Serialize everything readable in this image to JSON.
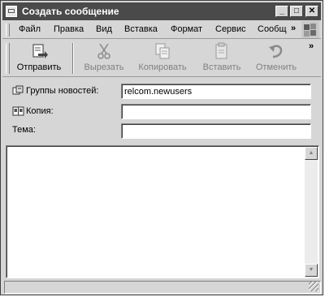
{
  "window": {
    "title": "Создать сообщение"
  },
  "titlebar_buttons": {
    "minimize": "_",
    "maximize": "□",
    "close": "✕"
  },
  "menu": {
    "items": [
      "Файл",
      "Правка",
      "Вид",
      "Вставка",
      "Формат",
      "Сервис",
      "Сообщ"
    ],
    "overflow": "»"
  },
  "toolbar": {
    "buttons": [
      {
        "label": "Отправить",
        "icon": "send-icon",
        "enabled": true
      },
      {
        "label": "Вырезать",
        "icon": "scissors-icon",
        "enabled": false
      },
      {
        "label": "Копировать",
        "icon": "copy-icon",
        "enabled": false
      },
      {
        "label": "Вставить",
        "icon": "paste-icon",
        "enabled": false
      },
      {
        "label": "Отменить",
        "icon": "undo-icon",
        "enabled": false
      }
    ],
    "overflow": "»"
  },
  "fields": {
    "newsgroups": {
      "label": "Группы новостей:",
      "value": "relcom.newusers",
      "icon": "newsgroup-icon"
    },
    "copy": {
      "label": "Копия:",
      "value": "",
      "icon": "address-book-icon"
    },
    "subject": {
      "label": "Тема:",
      "value": ""
    }
  },
  "scrollbar": {
    "up": "▲",
    "down": "▼"
  }
}
